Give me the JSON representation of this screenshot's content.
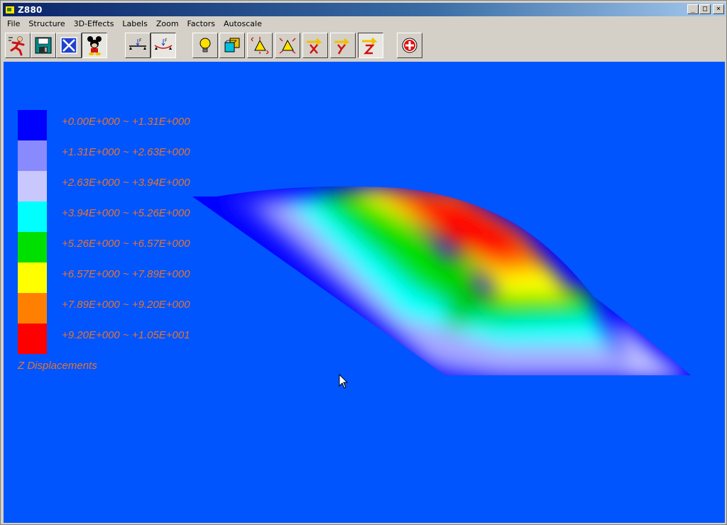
{
  "window": {
    "title": "Z880"
  },
  "title_buttons": {
    "minimize": "_",
    "maximize": "□",
    "close": "×"
  },
  "menu": [
    "File",
    "Structure",
    "3D-Effects",
    "Labels",
    "Zoom",
    "Factors",
    "Autoscale"
  ],
  "toolbar": {
    "buttons": [
      {
        "name": "run-icon"
      },
      {
        "name": "save-icon"
      },
      {
        "name": "close-model-icon"
      },
      {
        "name": "cartoon-icon"
      },
      {
        "name": "beam-load-icon"
      },
      {
        "name": "beam-deflected-icon"
      },
      {
        "name": "lightbulb-icon"
      },
      {
        "name": "3d-boxes-icon"
      },
      {
        "name": "triangle-move-icon"
      },
      {
        "name": "triangle-scale-icon"
      },
      {
        "name": "x-direction-icon"
      },
      {
        "name": "y-direction-icon"
      },
      {
        "name": "z-direction-icon"
      },
      {
        "name": "add-icon"
      }
    ],
    "z_label": "Z"
  },
  "legend": {
    "title": "Z Displacements",
    "ranges": [
      {
        "color": "#0000ff",
        "label": "+0.00E+000 ~ +1.31E+000"
      },
      {
        "color": "#8a8aff",
        "label": "+1.31E+000 ~ +2.63E+000"
      },
      {
        "color": "#c8c8ff",
        "label": "+2.63E+000 ~ +3.94E+000"
      },
      {
        "color": "#00ffff",
        "label": "+3.94E+000 ~ +5.26E+000"
      },
      {
        "color": "#00e000",
        "label": "+5.26E+000 ~ +6.57E+000"
      },
      {
        "color": "#ffff00",
        "label": "+6.57E+000 ~ +7.89E+000"
      },
      {
        "color": "#ff8000",
        "label": "+7.89E+000 ~ +9.20E+000"
      },
      {
        "color": "#ff0000",
        "label": "+9.20E+000 ~ +1.05E+001"
      }
    ]
  },
  "colors": {
    "canvas_bg": "#0055ff",
    "legend_text": "#e8742a"
  }
}
